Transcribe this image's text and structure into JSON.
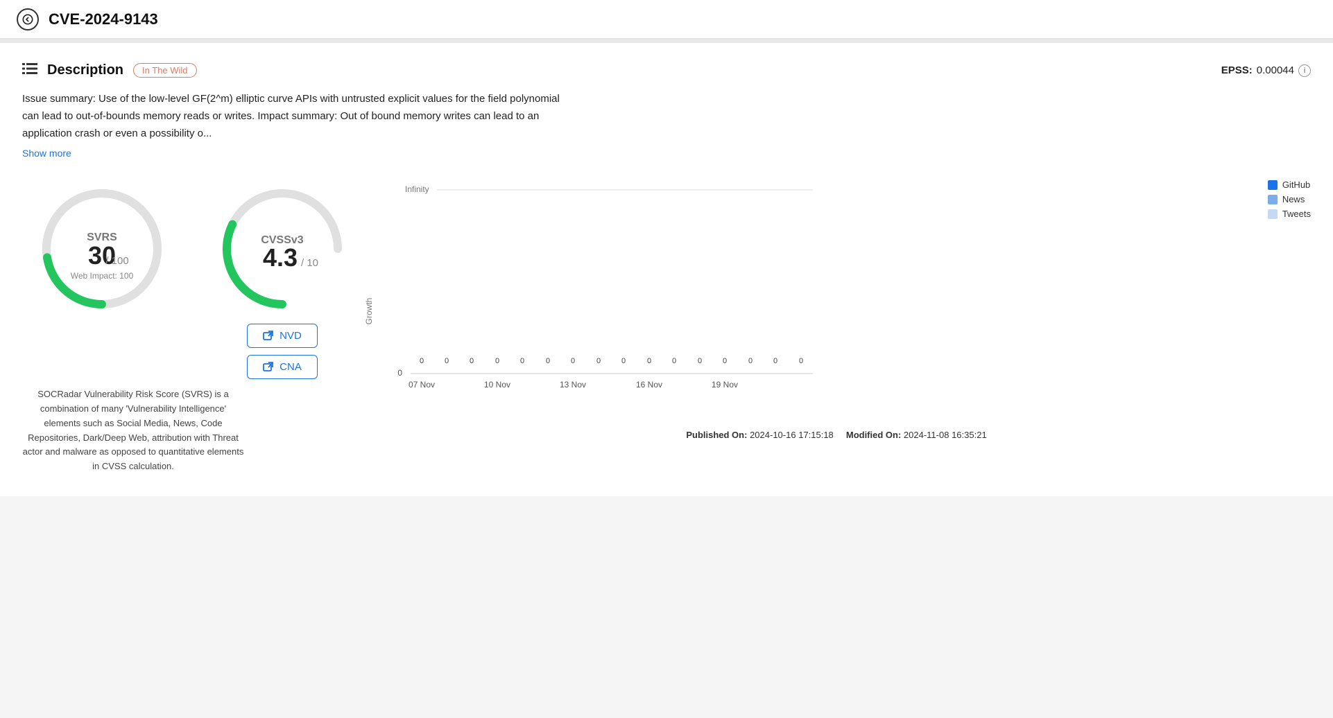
{
  "header": {
    "back_label": "back",
    "title": "CVE-2024-9143"
  },
  "section": {
    "icon": "list-icon",
    "title": "Description",
    "badge": "In The Wild",
    "epss_label": "EPSS:",
    "epss_value": "0.00044"
  },
  "description": {
    "text": "Issue summary: Use of the low-level GF(2^m) elliptic curve APIs with untrusted explicit values for the field polynomial can lead to out-of-bounds memory reads or writes. Impact summary: Out of bound memory writes can lead to an application crash or even a possibility o...",
    "show_more": "Show more"
  },
  "svrs": {
    "label": "SVRS",
    "value": "30",
    "max": "100",
    "web_impact_label": "Web Impact:",
    "web_impact_value": "100",
    "description": "SOCRadar Vulnerability Risk Score (SVRS) is a combination of many 'Vulnerability Intelligence' elements such as Social Media, News, Code Repositories, Dark/Deep Web, attribution with Threat actor and malware as opposed to quantitative elements in CVSS calculation."
  },
  "cvss": {
    "label": "CVSSv3",
    "value": "4.3",
    "max": "10"
  },
  "buttons": {
    "nvd": "NVD",
    "cna": "CNA"
  },
  "chart": {
    "y_label": "Growth",
    "infinity_label": "Infinity",
    "zero_label": "0",
    "x_labels": [
      "07 Nov",
      "10 Nov",
      "13 Nov",
      "16 Nov",
      "19 Nov"
    ],
    "legend": [
      {
        "label": "GitHub",
        "color": "#1a73e8"
      },
      {
        "label": "News",
        "color": "#7baee8"
      },
      {
        "label": "Tweets",
        "color": "#c5d8f5"
      }
    ],
    "bar_values": [
      "0",
      "0",
      "0",
      "0",
      "0",
      "0",
      "0",
      "0",
      "0",
      "0",
      "0",
      "0",
      "0",
      "0",
      "0",
      "0"
    ]
  },
  "footer": {
    "published_label": "Published On:",
    "published_value": "2024-10-16 17:15:18",
    "modified_label": "Modified On:",
    "modified_value": "2024-11-08 16:35:21"
  }
}
